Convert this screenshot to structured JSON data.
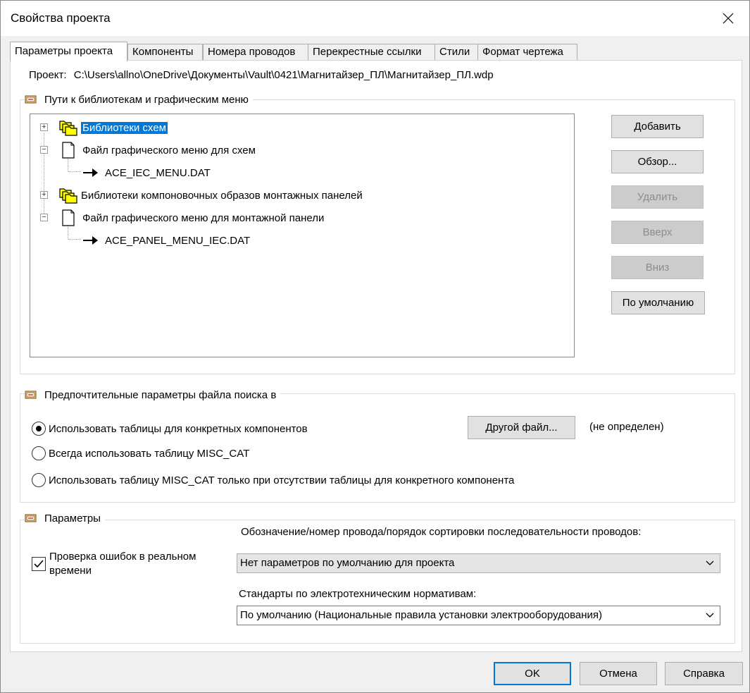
{
  "window": {
    "title": "Свойства проекта"
  },
  "tabs": [
    {
      "label": "Параметры проекта",
      "active": true
    },
    {
      "label": "Компоненты"
    },
    {
      "label": "Номера проводов"
    },
    {
      "label": "Перекрестные ссылки"
    },
    {
      "label": "Стили"
    },
    {
      "label": "Формат чертежа"
    }
  ],
  "project": {
    "label": "Проект:",
    "path": "C:\\Users\\allno\\OneDrive\\Документы\\Vault\\0421\\Магнитайзер_ПЛ\\Магнитайзер_ПЛ.wdp"
  },
  "libraries": {
    "header": "Пути к библиотекам и графическим меню",
    "tree": [
      {
        "label": "Библиотеки схем",
        "expander": "+",
        "icon": "folder-stack-icon",
        "selected": true
      },
      {
        "label": "Файл графического меню для схем",
        "expander": "−",
        "icon": "document-icon"
      },
      {
        "label": "ACE_IEC_MENU.DAT",
        "icon": "arrow-icon"
      },
      {
        "label": "Библиотеки компоновочных образов монтажных панелей",
        "expander": "+",
        "icon": "folder-stack-icon"
      },
      {
        "label": "Файл графического меню для монтажной панели",
        "expander": "−",
        "icon": "document-icon"
      },
      {
        "label": "ACE_PANEL_MENU_IEC.DAT",
        "icon": "arrow-icon"
      }
    ],
    "buttons": {
      "add": "Добавить",
      "browse": "Обзор...",
      "delete": "Удалить",
      "up": "Вверх",
      "down": "Вниз",
      "default": "По умолчанию"
    }
  },
  "search": {
    "header": "Предпочтительные параметры файла поиска в",
    "options": [
      {
        "label": "Использовать таблицы для конкретных компонентов",
        "checked": true
      },
      {
        "label": "Всегда использовать таблицу MISC_CAT",
        "checked": false
      },
      {
        "label": "Использовать таблицу MISC_CAT только при отсутствии таблицы для конкретного компонента",
        "checked": false
      }
    ],
    "other_file_button": "Другой файл...",
    "other_file_status": "(не определен)"
  },
  "params": {
    "header": "Параметры",
    "realtime_check": {
      "label_line1": "Проверка ошибок в реальном",
      "label_line2": "времени",
      "checked": true
    },
    "wire_sort_label": "Обозначение/номер провода/порядок сортировки последовательности проводов:",
    "wire_sort_value": "Нет параметров по умолчанию для проекта",
    "standards_label": "Стандарты по электротехническим нормативам:",
    "standards_value": "По умолчанию (Национальные правила установки электрооборудования)"
  },
  "footer": {
    "ok": "OK",
    "cancel": "Отмена",
    "help": "Справка"
  },
  "colors": {
    "accent": "#0078d7",
    "folder": "#ffff00"
  }
}
